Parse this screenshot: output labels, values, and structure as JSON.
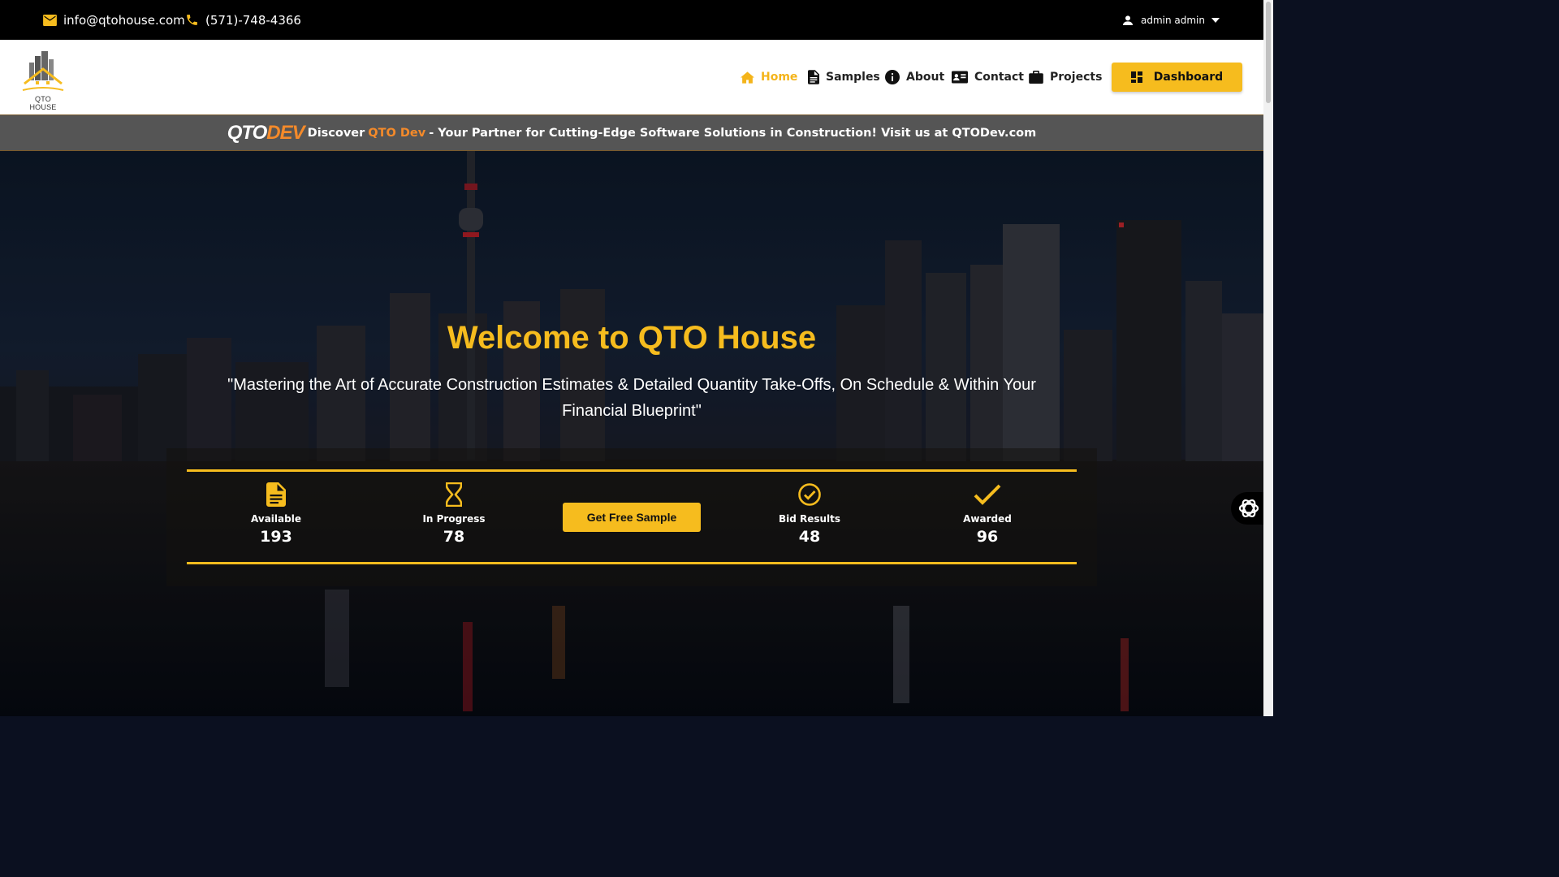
{
  "topbar": {
    "email": "info@qtohouse.com",
    "phone": "(571)-748-4366",
    "user": "admin admin"
  },
  "logo": {
    "text": "QTO HOUSE"
  },
  "nav": {
    "items": [
      {
        "label": "Home",
        "icon": "home-icon",
        "active": true
      },
      {
        "label": "Samples",
        "icon": "document-icon"
      },
      {
        "label": "About",
        "icon": "info-icon"
      },
      {
        "label": "Contact",
        "icon": "contact-card-icon"
      },
      {
        "label": "Projects",
        "icon": "briefcase-icon"
      }
    ],
    "dashboard_label": "Dashboard"
  },
  "banner": {
    "logo_q": "QTO",
    "logo_d": "DEV",
    "prefix": "Discover",
    "highlight": "QTO Dev",
    "text": "- Your Partner for Cutting-Edge Software Solutions in Construction! Visit us at QTODev.com"
  },
  "hero": {
    "title": "Welcome to QTO House",
    "subtitle": "\"Mastering the Art of Accurate Construction Estimates & Detailed Quantity Take-Offs, On Schedule & Within Your Financial Blueprint\""
  },
  "stats": {
    "available": {
      "label": "Available",
      "value": "193"
    },
    "in_progress": {
      "label": "In Progress",
      "value": "78"
    },
    "bid_results": {
      "label": "Bid Results",
      "value": "48"
    },
    "awarded": {
      "label": "Awarded",
      "value": "96"
    },
    "sample_button": "Get Free Sample"
  },
  "colors": {
    "accent": "#f6bc1e",
    "qtodev_orange": "#f48a2a",
    "topbar_bg": "#000000"
  }
}
